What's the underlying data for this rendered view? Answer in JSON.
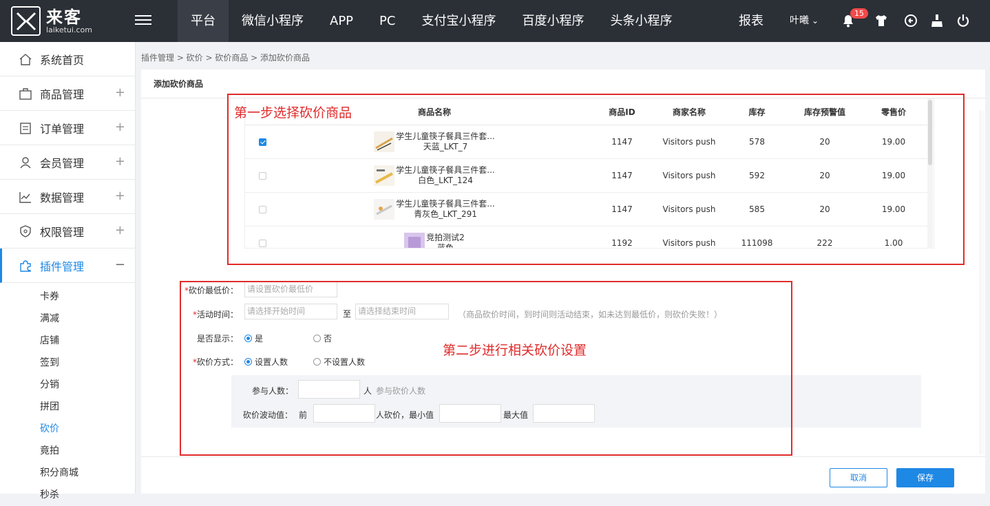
{
  "logo": {
    "cn": "来客",
    "en": "laiketui.com"
  },
  "nav": [
    "平台",
    "微信小程序",
    "APP",
    "PC",
    "支付宝小程序",
    "百度小程序",
    "头条小程序"
  ],
  "header": {
    "report": "报表",
    "user": "叶曦",
    "notification_count": "15"
  },
  "sidebar": {
    "items": [
      {
        "label": "系统首页",
        "icon": "home-icon"
      },
      {
        "label": "商品管理",
        "icon": "bag-icon"
      },
      {
        "label": "订单管理",
        "icon": "order-icon"
      },
      {
        "label": "会员管理",
        "icon": "member-icon"
      },
      {
        "label": "数据管理",
        "icon": "chart-icon"
      },
      {
        "label": "权限管理",
        "icon": "shield-icon"
      },
      {
        "label": "插件管理",
        "icon": "puzzle-icon"
      }
    ],
    "sub_items": [
      "卡券",
      "满减",
      "店铺",
      "签到",
      "分销",
      "拼团",
      "砍价",
      "竟拍",
      "积分商城",
      "秒杀"
    ]
  },
  "breadcrumb": "插件管理 > 砍价 > 砍价商品 > 添加砍价商品",
  "card_title": "添加砍价商品",
  "table": {
    "headers": [
      "商品名称",
      "商品ID",
      "商家名称",
      "库存",
      "库存预警值",
      "零售价"
    ],
    "rows": [
      {
        "checked": true,
        "name1": "学生儿童筷子餐具三件套...",
        "name2": "天蓝_LKT_7",
        "id": "1147",
        "shop": "Visitors push",
        "stock": "578",
        "warn": "20",
        "price": "19.00"
      },
      {
        "checked": false,
        "name1": "学生儿童筷子餐具三件套...",
        "name2": "白色_LKT_124",
        "id": "1147",
        "shop": "Visitors push",
        "stock": "592",
        "warn": "20",
        "price": "19.00"
      },
      {
        "checked": false,
        "name1": "学生儿童筷子餐具三件套...",
        "name2": "青灰色_LKT_291",
        "id": "1147",
        "shop": "Visitors push",
        "stock": "585",
        "warn": "20",
        "price": "19.00"
      },
      {
        "checked": false,
        "name1": "竞拍测试2",
        "name2": "蓝色",
        "id": "1192",
        "shop": "Visitors push",
        "stock": "111098",
        "warn": "222",
        "price": "1.00"
      }
    ]
  },
  "annotations": {
    "step1": "第一步选择砍价商品",
    "step2": "第二步进行相关砍价设置"
  },
  "form": {
    "min_price_label": "砍价最低价：",
    "min_price_placeholder": "请设置砍价最低价",
    "time_label": "活动时间：",
    "start_placeholder": "请选择开始时间",
    "to": "至",
    "end_placeholder": "请选择结束时间",
    "time_hint": "（商品砍价时间，到时间则活动结束，如未达到最低价，则砍价失败！）",
    "display_label": "是否显示：",
    "display_yes": "是",
    "display_no": "否",
    "mode_label": "砍价方式：",
    "mode_set": "设置人数",
    "mode_unset": "不设置人数",
    "participants_label": "参与人数：",
    "participants_unit": "人",
    "participants_hint": "参与砍价人数",
    "fluct_label": "砍价波动值：",
    "fluct_prefix": "前",
    "fluct_mid": "人砍价，最小值",
    "fluct_max": "最大值"
  },
  "buttons": {
    "cancel": "取消",
    "save": "保存"
  },
  "colors": {
    "accent": "#1e88e5",
    "annotation": "#e12b2b",
    "topbar": "#2b2f36"
  }
}
